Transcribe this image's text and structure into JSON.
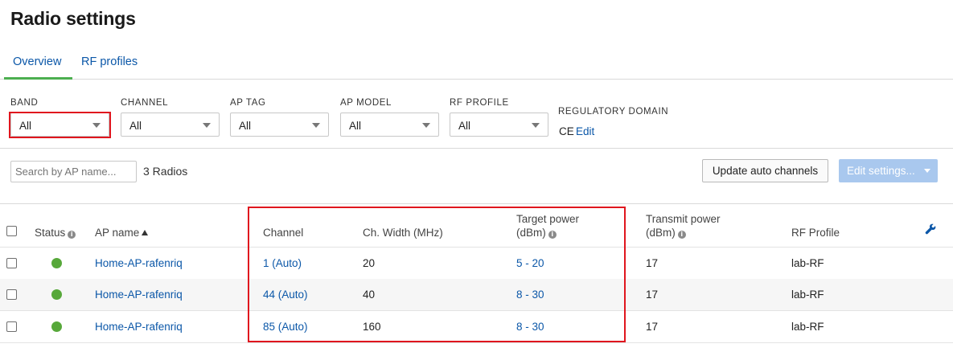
{
  "page": {
    "title": "Radio settings"
  },
  "tabs": [
    {
      "label": "Overview",
      "active": true
    },
    {
      "label": "RF profiles",
      "active": false
    }
  ],
  "filters": {
    "band": {
      "label": "BAND",
      "value": "All"
    },
    "channel": {
      "label": "CHANNEL",
      "value": "All"
    },
    "ap_tag": {
      "label": "AP TAG",
      "value": "All"
    },
    "ap_model": {
      "label": "AP MODEL",
      "value": "All"
    },
    "rf_profile": {
      "label": "RF PROFILE",
      "value": "All"
    },
    "regulatory_domain": {
      "label": "REGULATORY DOMAIN",
      "value": "CE",
      "edit_label": "Edit"
    }
  },
  "toolbar": {
    "search_placeholder": "Search by AP name...",
    "radio_count": "3 Radios",
    "update_button": "Update auto channels",
    "edit_button": "Edit settings..."
  },
  "table": {
    "columns": {
      "status": "Status",
      "ap_name": "AP name",
      "channel": "Channel",
      "width": "Ch. Width (MHz)",
      "target_power_1": "Target power",
      "target_power_2": "(dBm)",
      "transmit_power_1": "Transmit power",
      "transmit_power_2": "(dBm)",
      "rf_profile": "RF Profile"
    },
    "rows": [
      {
        "ap_name": "Home-AP-rafenriq",
        "channel": "1 (Auto)",
        "width": "20",
        "target_power": "5 - 20",
        "transmit_power": "17",
        "rf_profile": "lab-RF"
      },
      {
        "ap_name": "Home-AP-rafenriq",
        "channel": "44 (Auto)",
        "width": "40",
        "target_power": "8 - 30",
        "transmit_power": "17",
        "rf_profile": "lab-RF"
      },
      {
        "ap_name": "Home-AP-rafenriq",
        "channel": "85 (Auto)",
        "width": "160",
        "target_power": "8 - 30",
        "transmit_power": "17",
        "rf_profile": "lab-RF"
      }
    ]
  },
  "colors": {
    "link": "#0b57a8",
    "status_online": "#57a83a",
    "tab_active_underline": "#4caf50",
    "highlight_box": "#e0161e",
    "disabled_button": "#a9c8ee"
  },
  "icons": [
    "info-icon",
    "sort-ascending-icon",
    "wrench-icon",
    "status-online-icon",
    "dropdown-caret-icon"
  ]
}
